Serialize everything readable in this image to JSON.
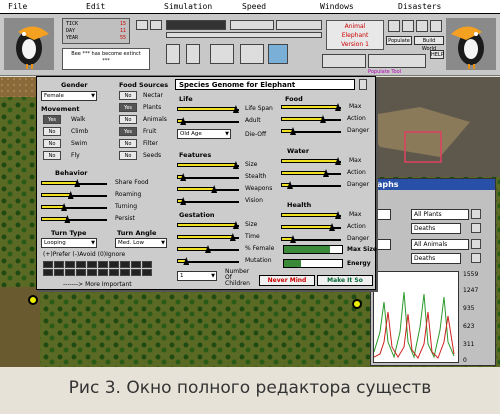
{
  "menu": [
    "File",
    "Edit",
    "Simulation",
    "Speed",
    "Windows",
    "Disasters"
  ],
  "dateplate": {
    "tick_label": "TICK",
    "tick": "15",
    "day_label": "DAY",
    "day": "11",
    "year_label": "YEAR",
    "year": "55"
  },
  "message": "Bee *** has become extinct\n***",
  "animal_selector": {
    "kind": "Animal",
    "name": "Elephant",
    "version": "Version 1"
  },
  "toolbar_buttons": {
    "populate": "Populate",
    "build_world": "Build World",
    "help": "HELP"
  },
  "populate_tool": "Populate Tool",
  "editor": {
    "title": "Species Genome for Elephant",
    "gender": {
      "header": "Gender",
      "value": "Female"
    },
    "movement": {
      "header": "Movement",
      "rows": [
        {
          "state": "Yes",
          "label": "Walk"
        },
        {
          "state": "No",
          "label": "Climb"
        },
        {
          "state": "No",
          "label": "Swim"
        },
        {
          "state": "No",
          "label": "Fly"
        }
      ]
    },
    "food_sources": {
      "header": "Food Sources",
      "rows": [
        {
          "state": "No",
          "label": "Nectar"
        },
        {
          "state": "Yes",
          "label": "Plants"
        },
        {
          "state": "No",
          "label": "Animals"
        },
        {
          "state": "Yes",
          "label": "Fruit"
        },
        {
          "state": "No",
          "label": "Filter"
        },
        {
          "state": "No",
          "label": "Seeds"
        }
      ]
    },
    "behavior": {
      "header": "Behavior",
      "rows": [
        {
          "label": "Share Food",
          "level": 0.55
        },
        {
          "label": "Roaming",
          "level": 0.45
        },
        {
          "label": "Turning",
          "level": 0.35
        },
        {
          "label": "Persist",
          "level": 0.4
        }
      ]
    },
    "turn_type": {
      "header": "Turn Type",
      "value": "Looping"
    },
    "turn_angle": {
      "header": "Turn Angle",
      "value": "Med. Low"
    },
    "prefer_note": "(+)Prefer (-)Avoid (0)Ignore",
    "more_important": "-------> More Important",
    "life": {
      "header": "Life",
      "rows": [
        {
          "label": "Life Span",
          "level": 0.95
        },
        {
          "label": "Adult",
          "level": 0.1
        }
      ],
      "die_off": {
        "value": "Old Age",
        "label": "Die-Off"
      }
    },
    "features": {
      "header": "Features",
      "rows": [
        {
          "label": "Size",
          "level": 0.95
        },
        {
          "label": "Stealth",
          "level": 0.1
        },
        {
          "label": "Weapons",
          "level": 0.6
        },
        {
          "label": "Vision",
          "level": 0.1
        }
      ]
    },
    "gestation": {
      "header": "Gestation",
      "rows": [
        {
          "label": "Size",
          "level": 0.95
        },
        {
          "label": "Time",
          "level": 0.9
        },
        {
          "label": "% Female",
          "level": 0.5
        },
        {
          "label": "Mutation",
          "level": 0.15
        }
      ],
      "children": {
        "value": "1",
        "label": "Number Of Children"
      }
    },
    "food": {
      "header": "Food",
      "rows": [
        {
          "label": "Action",
          "level": 0.7
        },
        {
          "label": "Danger",
          "level": 0.2
        }
      ],
      "max": "Max"
    },
    "water": {
      "header": "Water",
      "rows": [
        {
          "label": "Action",
          "level": 0.75
        },
        {
          "label": "Danger",
          "level": 0.15
        }
      ],
      "max": "Max"
    },
    "health": {
      "header": "Health",
      "rows": [
        {
          "label": "Action",
          "level": 0.85
        },
        {
          "label": "Danger",
          "level": 0.2
        }
      ],
      "max": "Max"
    },
    "max_size": {
      "label": "Max Size",
      "level": 0.8
    },
    "energy": {
      "label": "Energy",
      "level": 0.3
    },
    "never_mind": "Never Mind",
    "make_it_so": "Make It So"
  },
  "graphs": {
    "title": "raphs",
    "plants_select": "All Plants",
    "plants_metric": "Deaths",
    "animals_select": "All Animals",
    "animals_metric": "Deaths",
    "y_ticks": [
      "1559",
      "1247",
      "935",
      "623",
      "311",
      "0"
    ]
  },
  "caption": "Рис 3. Окно полного редактора существ"
}
